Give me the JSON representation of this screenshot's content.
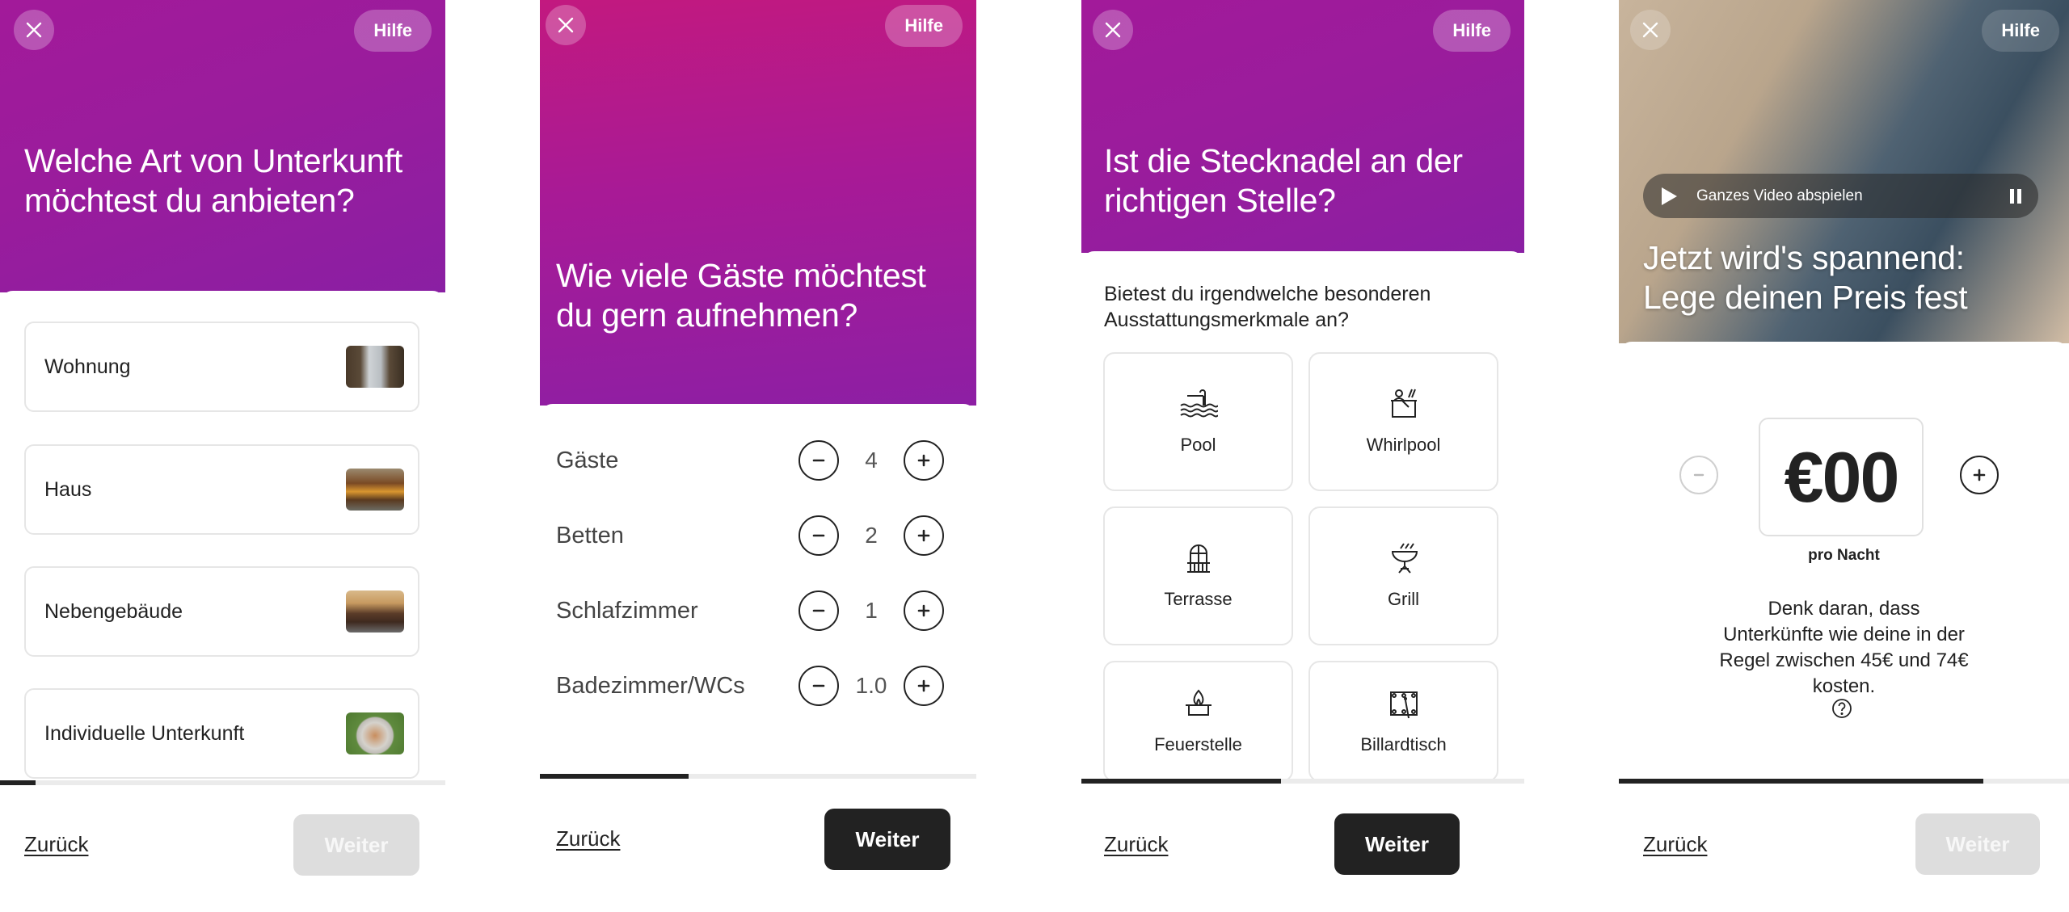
{
  "common": {
    "help_label": "Hilfe",
    "back_label": "Zurück",
    "next_label": "Weiter"
  },
  "screens": [
    {
      "title": "Welche Art von Unterkunft möchtest du anbieten?",
      "options": [
        {
          "label": "Wohnung",
          "thumb": "apartment-photo"
        },
        {
          "label": "Haus",
          "thumb": "house-photo"
        },
        {
          "label": "Nebengebäude",
          "thumb": "secondary-unit-photo"
        },
        {
          "label": "Individuelle Unterkunft",
          "thumb": "unique-space-photo"
        }
      ],
      "progress_fraction": 0.08,
      "next_enabled": false
    },
    {
      "title": "Wie viele Gäste möchtest du gern aufnehmen?",
      "counters": [
        {
          "label": "Gäste",
          "value": "4"
        },
        {
          "label": "Betten",
          "value": "2"
        },
        {
          "label": "Schlafzimmer",
          "value": "1"
        },
        {
          "label": "Badezimmer/WCs",
          "value": "1.0"
        }
      ],
      "progress_fraction": 0.34,
      "next_enabled": true
    },
    {
      "title": "Ist die Stecknadel an der richtigen Stelle?",
      "question": "Bietest du irgendwelche besonderen Ausstattungsmerkmale an?",
      "amenities": [
        {
          "label": "Pool",
          "icon": "pool-icon"
        },
        {
          "label": "Whirlpool",
          "icon": "hot-tub-icon"
        },
        {
          "label": "Terrasse",
          "icon": "patio-icon"
        },
        {
          "label": "Grill",
          "icon": "grill-icon"
        },
        {
          "label": "Feuerstelle",
          "icon": "fire-pit-icon"
        },
        {
          "label": "Billardtisch",
          "icon": "pool-table-icon"
        }
      ],
      "progress_fraction": 0.45,
      "next_enabled": true
    },
    {
      "title": "Jetzt wird's spannend: Lege deinen Preis fest",
      "video_label": "Ganzes Video abspielen",
      "price": "€00",
      "per_night": "pro Nacht",
      "hint": "Denk daran, dass Unterkünfte wie deine in der Regel zwischen 45€ und 74€ kosten.",
      "progress_fraction": 0.81,
      "next_enabled": false
    }
  ],
  "colors": {
    "hero_purple": "#9a1c9c",
    "hero_magenta": "#c2197f",
    "primary_button": "#222222",
    "disabled_button": "#dddddd",
    "progress_track": "#ebebeb"
  }
}
